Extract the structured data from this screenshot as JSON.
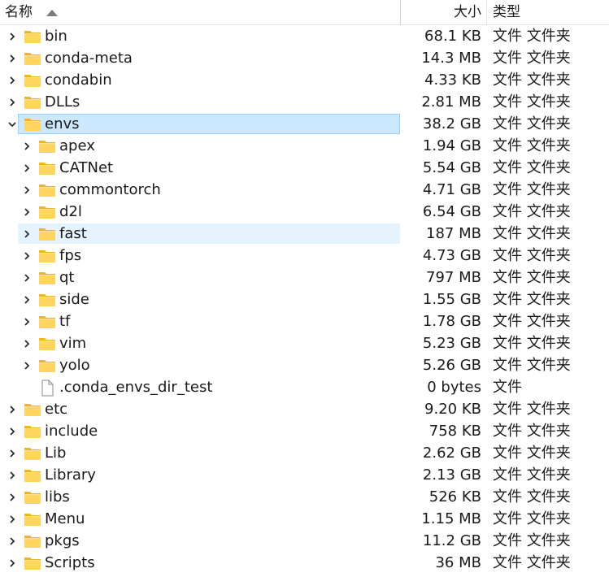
{
  "header": {
    "name_label": "名称",
    "size_label": "大小",
    "type_label": "类型"
  },
  "colors": {
    "folder_body": "#ffd45f",
    "folder_tab": "#f0b429",
    "selection": "#cce8ff",
    "hover": "#e5f3ff"
  },
  "icons": {
    "expand": "chevron-right-icon",
    "collapse": "chevron-down-icon",
    "folder": "folder-icon",
    "file": "file-icon"
  },
  "rows": [
    {
      "name": "bin",
      "size": "68.1 KB",
      "type": "文件 文件夹",
      "depth": 0,
      "kind": "folder",
      "state": "collapsed"
    },
    {
      "name": "conda-meta",
      "size": "14.3 MB",
      "type": "文件 文件夹",
      "depth": 0,
      "kind": "folder",
      "state": "collapsed"
    },
    {
      "name": "condabin",
      "size": "4.33 KB",
      "type": "文件 文件夹",
      "depth": 0,
      "kind": "folder",
      "state": "collapsed"
    },
    {
      "name": "DLLs",
      "size": "2.81 MB",
      "type": "文件 文件夹",
      "depth": 0,
      "kind": "folder",
      "state": "collapsed"
    },
    {
      "name": "envs",
      "size": "38.2 GB",
      "type": "文件 文件夹",
      "depth": 0,
      "kind": "folder",
      "state": "expanded",
      "selected": true
    },
    {
      "name": "apex",
      "size": "1.94 GB",
      "type": "文件 文件夹",
      "depth": 1,
      "kind": "folder",
      "state": "collapsed"
    },
    {
      "name": "CATNet",
      "size": "5.54 GB",
      "type": "文件 文件夹",
      "depth": 1,
      "kind": "folder",
      "state": "collapsed"
    },
    {
      "name": "commontorch",
      "size": "4.71 GB",
      "type": "文件 文件夹",
      "depth": 1,
      "kind": "folder",
      "state": "collapsed"
    },
    {
      "name": "d2l",
      "size": "6.54 GB",
      "type": "文件 文件夹",
      "depth": 1,
      "kind": "folder",
      "state": "collapsed"
    },
    {
      "name": "fast",
      "size": "187 MB",
      "type": "文件 文件夹",
      "depth": 1,
      "kind": "folder",
      "state": "collapsed",
      "hover": true
    },
    {
      "name": "fps",
      "size": "4.73 GB",
      "type": "文件 文件夹",
      "depth": 1,
      "kind": "folder",
      "state": "collapsed"
    },
    {
      "name": "qt",
      "size": "797 MB",
      "type": "文件 文件夹",
      "depth": 1,
      "kind": "folder",
      "state": "collapsed"
    },
    {
      "name": "side",
      "size": "1.55 GB",
      "type": "文件 文件夹",
      "depth": 1,
      "kind": "folder",
      "state": "collapsed"
    },
    {
      "name": "tf",
      "size": "1.78 GB",
      "type": "文件 文件夹",
      "depth": 1,
      "kind": "folder",
      "state": "collapsed"
    },
    {
      "name": "vim",
      "size": "5.23 GB",
      "type": "文件 文件夹",
      "depth": 1,
      "kind": "folder",
      "state": "collapsed"
    },
    {
      "name": "yolo",
      "size": "5.26 GB",
      "type": "文件 文件夹",
      "depth": 1,
      "kind": "folder",
      "state": "collapsed"
    },
    {
      "name": ".conda_envs_dir_test",
      "size": "0 bytes",
      "type": "文件",
      "depth": 1,
      "kind": "file",
      "state": "none"
    },
    {
      "name": "etc",
      "size": "9.20 KB",
      "type": "文件 文件夹",
      "depth": 0,
      "kind": "folder",
      "state": "collapsed"
    },
    {
      "name": "include",
      "size": "758 KB",
      "type": "文件 文件夹",
      "depth": 0,
      "kind": "folder",
      "state": "collapsed"
    },
    {
      "name": "Lib",
      "size": "2.62 GB",
      "type": "文件 文件夹",
      "depth": 0,
      "kind": "folder",
      "state": "collapsed"
    },
    {
      "name": "Library",
      "size": "2.13 GB",
      "type": "文件 文件夹",
      "depth": 0,
      "kind": "folder",
      "state": "collapsed"
    },
    {
      "name": "libs",
      "size": "526 KB",
      "type": "文件 文件夹",
      "depth": 0,
      "kind": "folder",
      "state": "collapsed"
    },
    {
      "name": "Menu",
      "size": "1.15 MB",
      "type": "文件 文件夹",
      "depth": 0,
      "kind": "folder",
      "state": "collapsed"
    },
    {
      "name": "pkgs",
      "size": "11.2 GB",
      "type": "文件 文件夹",
      "depth": 0,
      "kind": "folder",
      "state": "collapsed"
    },
    {
      "name": "Scripts",
      "size": "36 MB",
      "type": "文件 文件夹",
      "depth": 0,
      "kind": "folder",
      "state": "collapsed"
    }
  ]
}
